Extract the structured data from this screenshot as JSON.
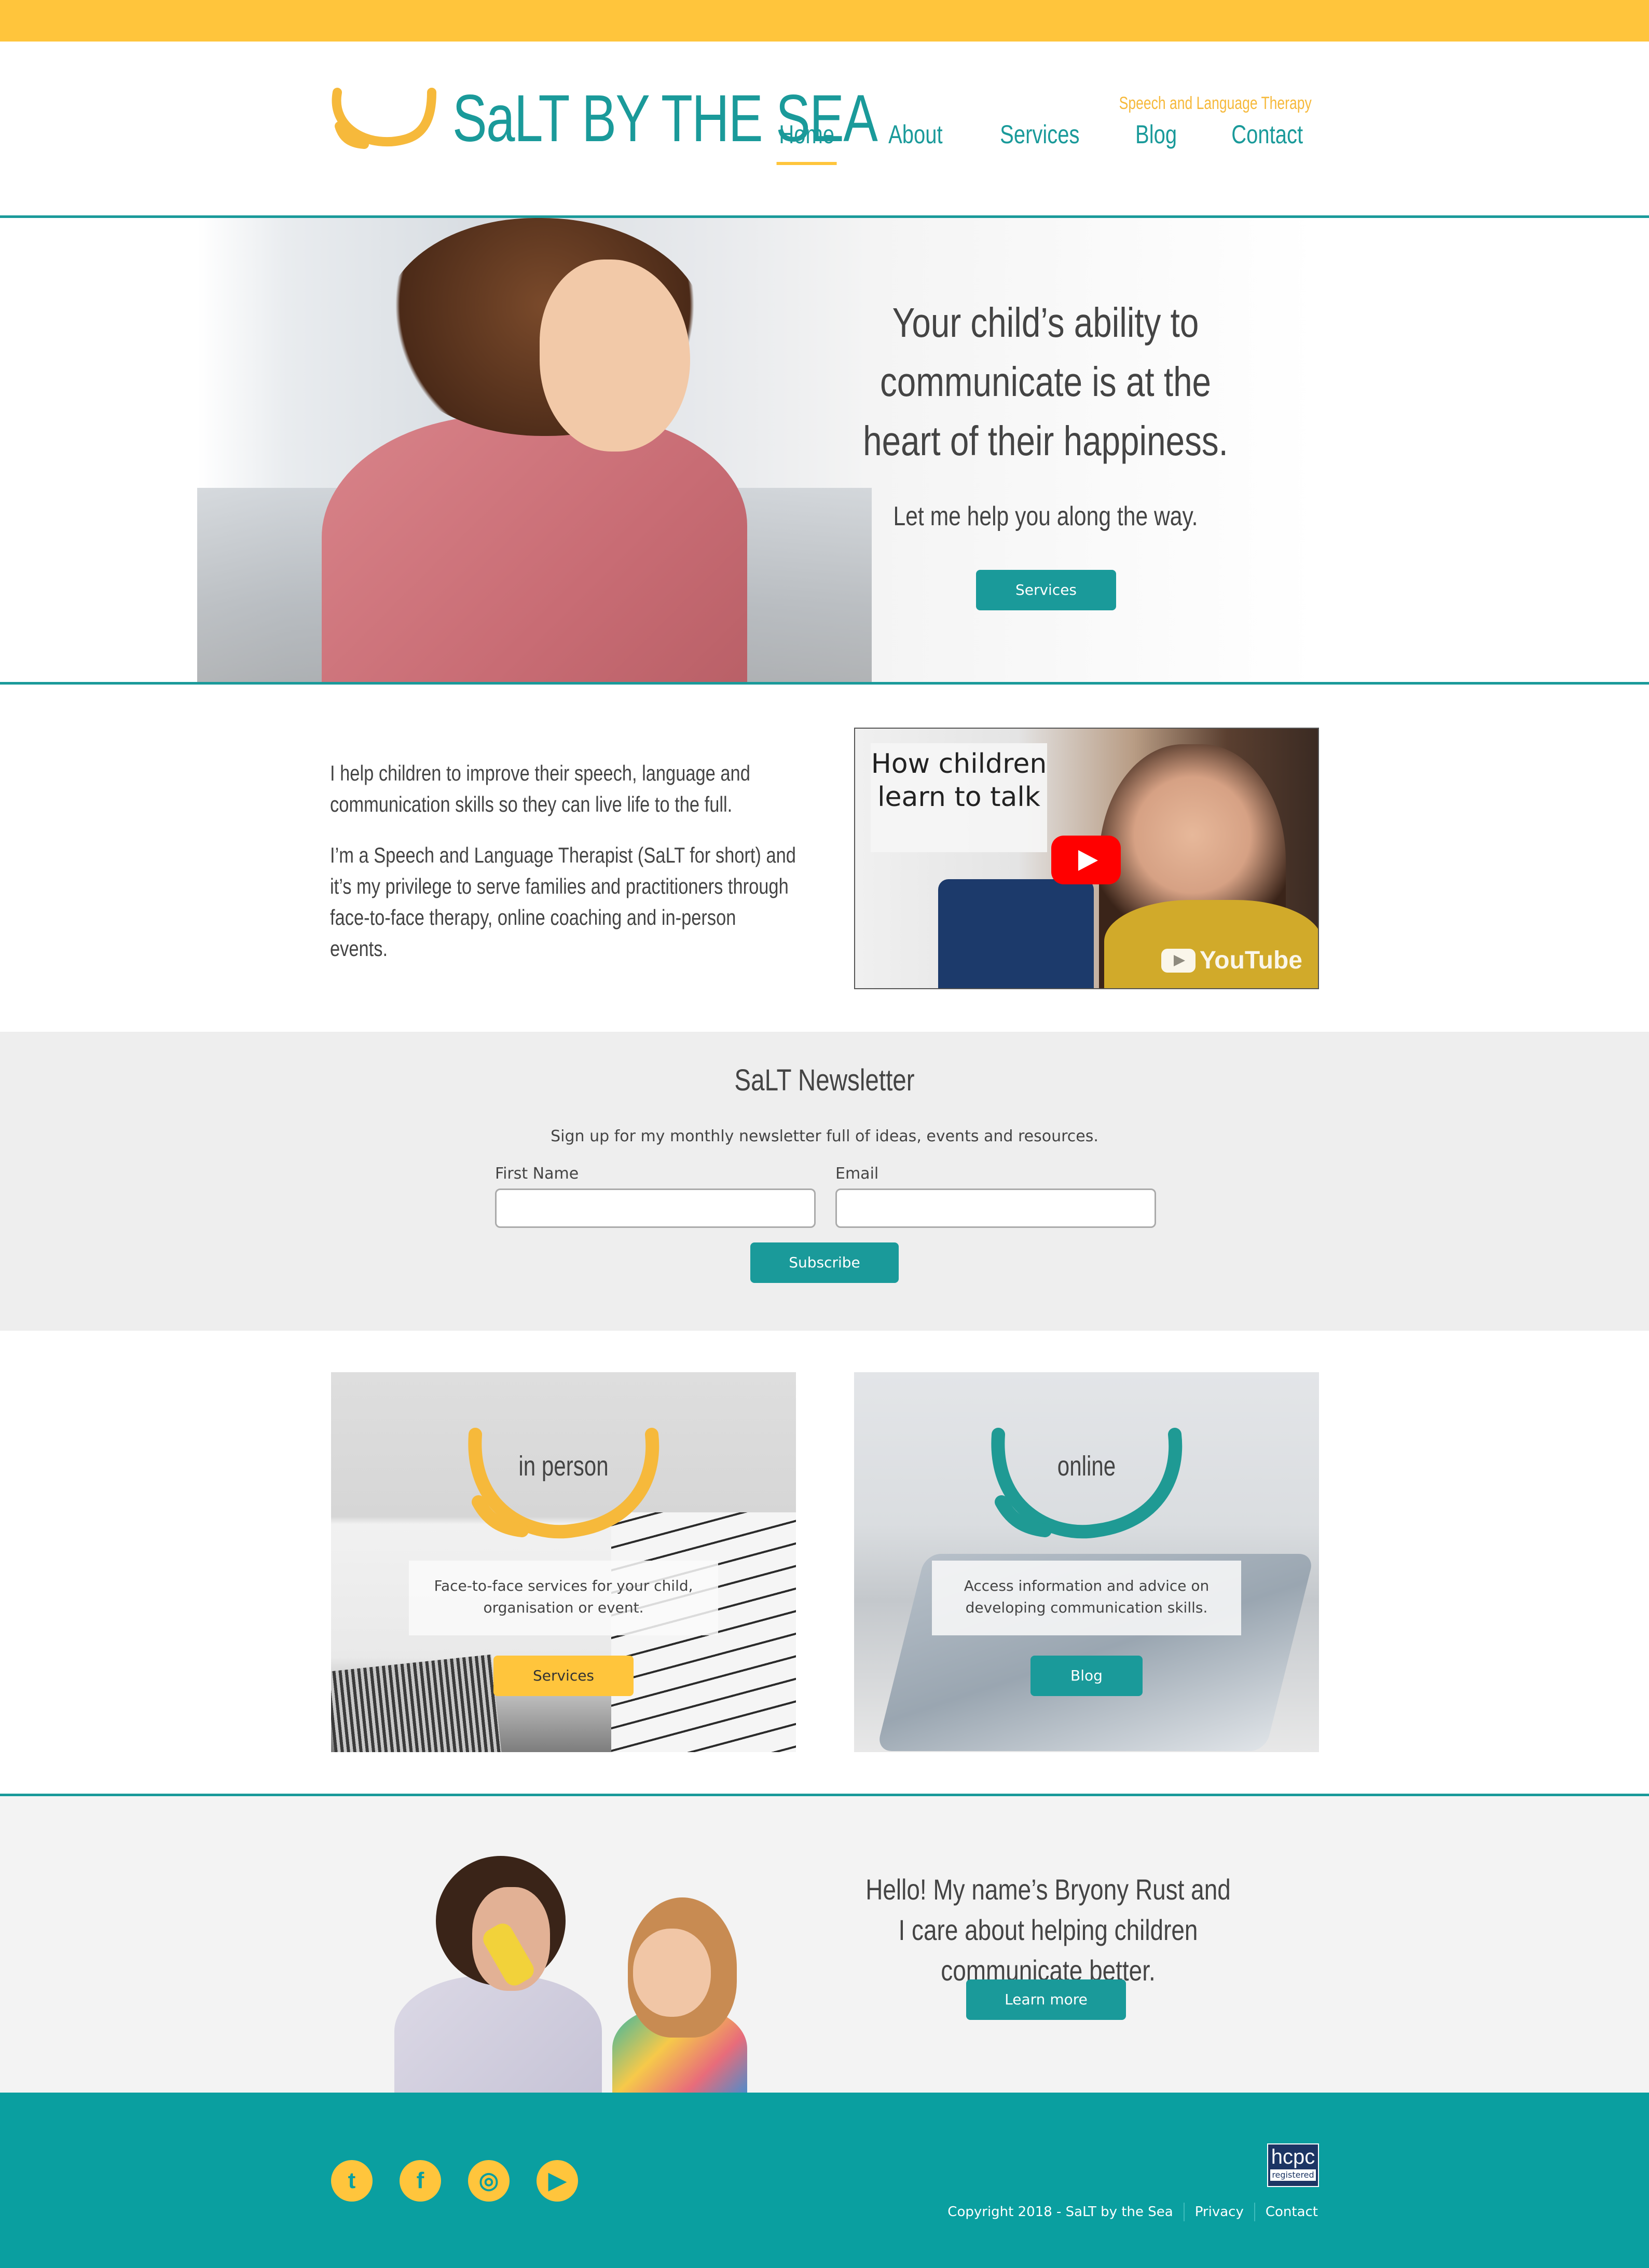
{
  "brand": {
    "name": "SaLT BY THE SEA",
    "tagline": "Speech and Language Therapy",
    "accent_teal": "#1a9a9a",
    "accent_yellow": "#ffc53c"
  },
  "nav": {
    "items": [
      {
        "label": "Home",
        "active": true
      },
      {
        "label": "About",
        "active": false
      },
      {
        "label": "Services",
        "active": false
      },
      {
        "label": "Blog",
        "active": false
      },
      {
        "label": "Contact",
        "active": false
      }
    ]
  },
  "hero": {
    "heading": "Your child’s ability to communicate is at the heart of their happiness.",
    "subheading": "Let me help you along the way.",
    "button_label": "Services"
  },
  "intro": {
    "paragraph_1": "I help children to improve their speech, language and communication skills so they can live life to the full.",
    "paragraph_2": "I’m a Speech and Language Therapist (SaLT for short) and it’s my privilege to serve families and practitioners through face-to-face therapy, online coaching and in-person events."
  },
  "video": {
    "caption": "How children learn to talk",
    "platform": "YouTube",
    "play_icon": "play-icon"
  },
  "newsletter": {
    "title": "SaLT Newsletter",
    "subtitle": "Sign up for my monthly newsletter full of ideas, events and resources.",
    "first_name_label": "First Name",
    "first_name_value": "",
    "email_label": "Email",
    "email_value": "",
    "button_label": "Subscribe"
  },
  "cards": [
    {
      "title": "in person",
      "text": "Face-to-face services for your child, organisation or event.",
      "button_label": "Services",
      "smile_color": "#f6b93b"
    },
    {
      "title": "online",
      "text": "Access information and advice on developing communication skills.",
      "button_label": "Blog",
      "smile_color": "#1f9a94"
    }
  ],
  "about": {
    "text": "Hello! My name’s Bryony Rust and I care about helping children communicate better.",
    "button_label": "Learn more"
  },
  "footer": {
    "social": [
      {
        "icon": "twitter-icon",
        "glyph": "t"
      },
      {
        "icon": "facebook-icon",
        "glyph": "f"
      },
      {
        "icon": "instagram-icon",
        "glyph": "◎"
      },
      {
        "icon": "youtube-icon",
        "glyph": "▶"
      }
    ],
    "badge_text": "hcpc",
    "badge_sub": "registered",
    "copyright": "Copyright 2018 - SaLT by the Sea",
    "links": [
      "Privacy",
      "Contact"
    ]
  }
}
